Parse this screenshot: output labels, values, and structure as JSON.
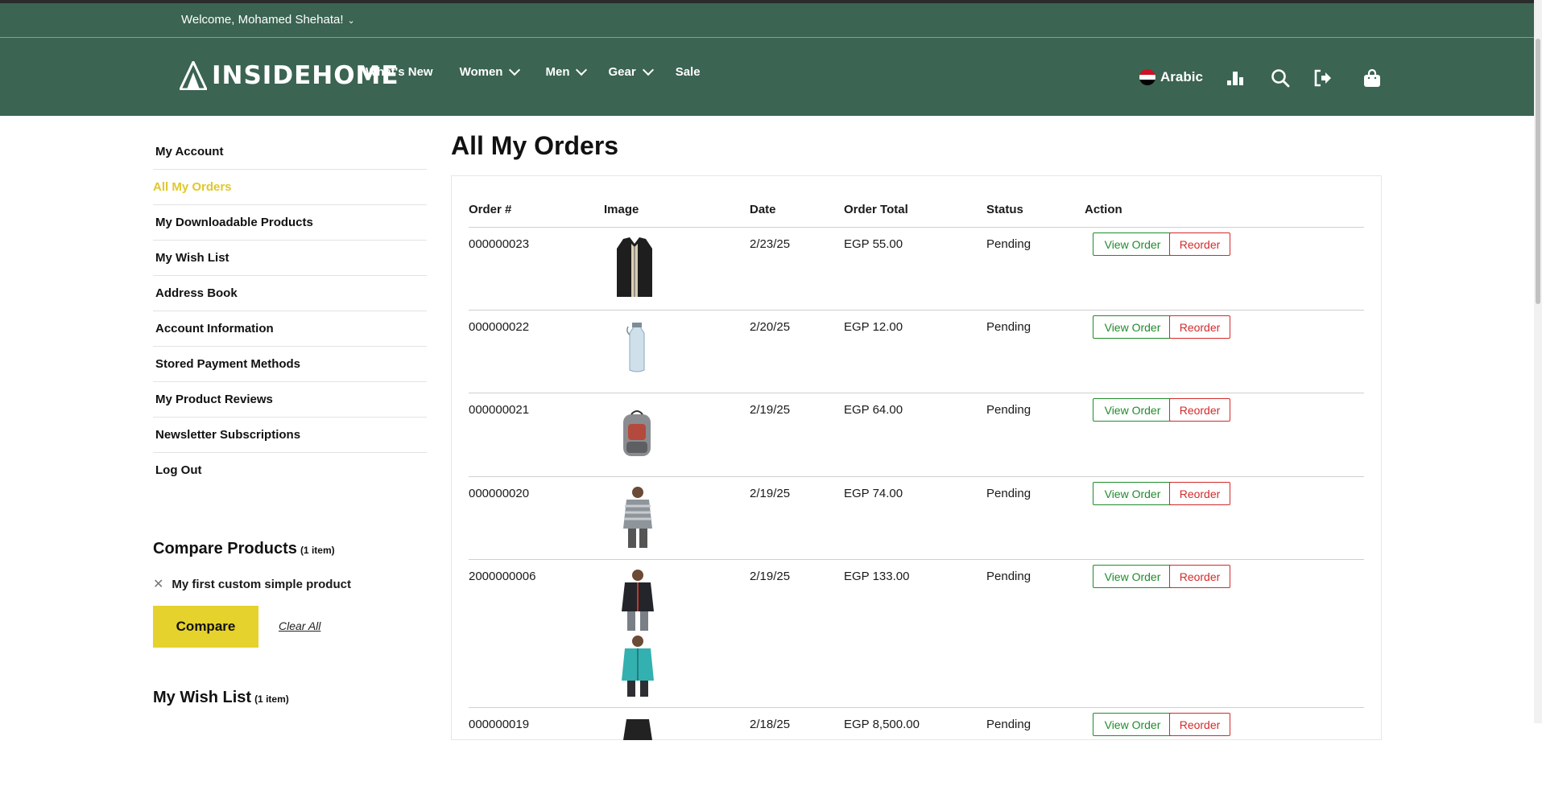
{
  "topbar": {
    "welcome": "Welcome, Mohamed Shehata!"
  },
  "header": {
    "brand": "INSIDEHOME",
    "nav": [
      {
        "label": "What's New",
        "dropdown": false
      },
      {
        "label": "Women",
        "dropdown": true
      },
      {
        "label": "Men",
        "dropdown": true
      },
      {
        "label": "Gear",
        "dropdown": true
      },
      {
        "label": "Sale",
        "dropdown": false
      }
    ],
    "language": "Arabic",
    "icons": [
      "chart-icon",
      "search-icon",
      "logout-icon",
      "cart-icon"
    ]
  },
  "colors": {
    "header_bg": "#3b6452",
    "accent": "#e5d22d",
    "view_btn": "#1f8c2b",
    "reorder_btn": "#d32a2a"
  },
  "sidebar": {
    "items": [
      {
        "label": "My Account"
      },
      {
        "label": "All My Orders",
        "active": true
      },
      {
        "label": "My Downloadable Products"
      },
      {
        "label": "My Wish List"
      },
      {
        "label": "Address Book"
      },
      {
        "label": "Account Information"
      },
      {
        "label": "Stored Payment Methods"
      },
      {
        "label": "My Product Reviews"
      },
      {
        "label": "Newsletter Subscriptions"
      },
      {
        "label": "Log Out"
      }
    ],
    "compare": {
      "title": "Compare Products",
      "count": "(1 item)",
      "item": "My first custom simple product",
      "compare_label": "Compare",
      "clear_label": "Clear All"
    },
    "wishlist": {
      "title": "My Wish List",
      "count": "(1 item)"
    }
  },
  "main": {
    "title": "All My Orders",
    "columns": [
      "Order #",
      "Image",
      "Date",
      "Order Total",
      "Status",
      "Action"
    ],
    "view_label": "View Order",
    "reorder_label": "Reorder",
    "orders": [
      {
        "id": "000000023",
        "date": "2/23/25",
        "total": "EGP 55.00",
        "status": "Pending",
        "images": [
          "vest-image"
        ]
      },
      {
        "id": "000000022",
        "date": "2/20/25",
        "total": "EGP 12.00",
        "status": "Pending",
        "images": [
          "water-bottle-image"
        ]
      },
      {
        "id": "000000021",
        "date": "2/19/25",
        "total": "EGP 64.00",
        "status": "Pending",
        "images": [
          "backpack-image"
        ]
      },
      {
        "id": "000000020",
        "date": "2/19/25",
        "total": "EGP 74.00",
        "status": "Pending",
        "images": [
          "striped-hoodie-image"
        ]
      },
      {
        "id": "2000000006",
        "date": "2/19/25",
        "total": "EGP 133.00",
        "status": "Pending",
        "images": [
          "black-jacket-image",
          "teal-hoodie-image"
        ]
      },
      {
        "id": "000000019",
        "date": "2/18/25",
        "total": "EGP 8,500.00",
        "status": "Pending",
        "images": [
          "dark-item-image"
        ]
      }
    ]
  }
}
